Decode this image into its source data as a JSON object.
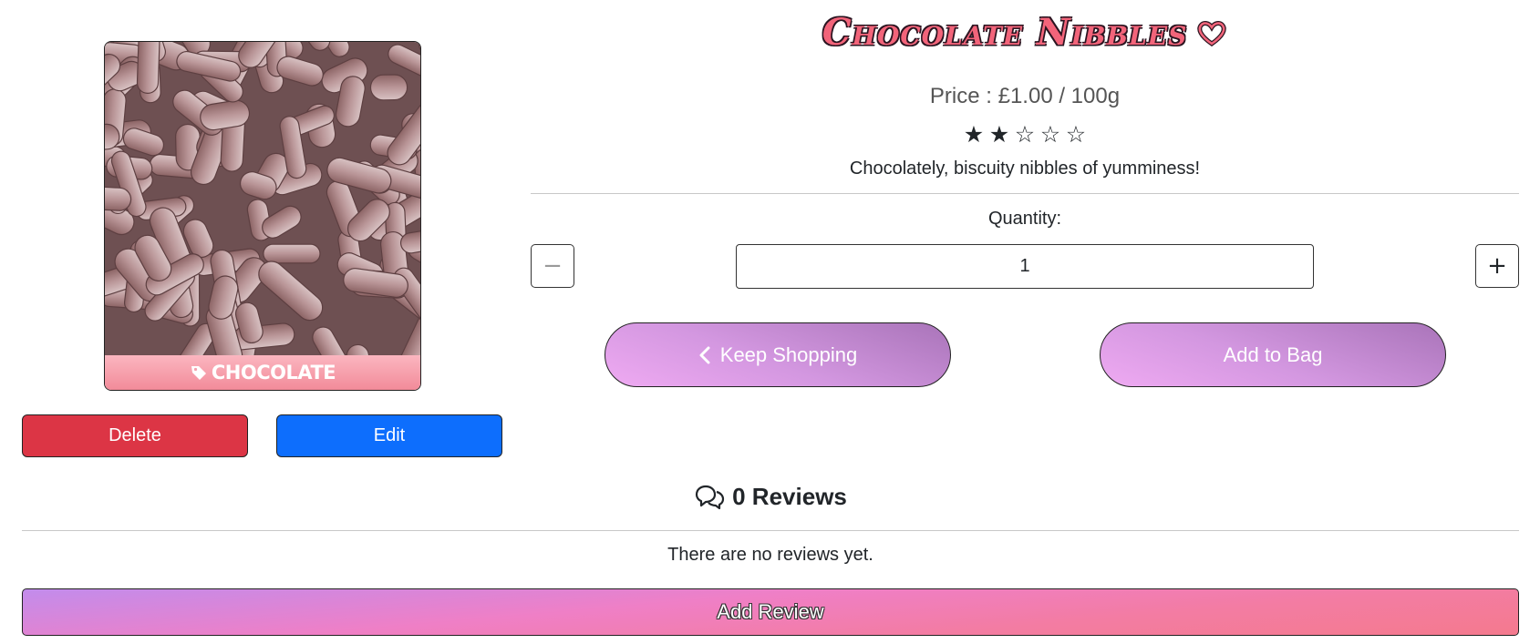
{
  "product": {
    "title": "Chocolate Nibbles",
    "price": "Price : £1.00 / 100g",
    "rating": {
      "value": 2,
      "max": 5
    },
    "description": "Chocolately, biscuity nibbles of yumminess!",
    "category": "CHOCOLATE",
    "image_alt": "chocolate nibbles photo"
  },
  "admin": {
    "delete_label": "Delete",
    "edit_label": "Edit"
  },
  "quantity": {
    "label": "Quantity:",
    "value": "1",
    "minus": "−",
    "plus": "+"
  },
  "actions": {
    "keep_shopping": "Keep Shopping",
    "add_to_bag": "Add to Bag"
  },
  "reviews": {
    "heading": "0 Reviews",
    "empty_text": "There are no reviews yet.",
    "add_label": "Add Review"
  },
  "colors": {
    "title": "#f2647a",
    "delete": "#dc3545",
    "edit": "#0d6efd",
    "tag": "#f28b9a",
    "pill": "#d397e0"
  },
  "icons": {
    "title_heart": "heart-outline-icon",
    "tag": "tag-icon",
    "keep_shopping": "chevron-left-icon",
    "reviews": "chat-bubbles-icon",
    "star_filled": "star-filled-icon",
    "star_empty": "star-outline-icon"
  }
}
